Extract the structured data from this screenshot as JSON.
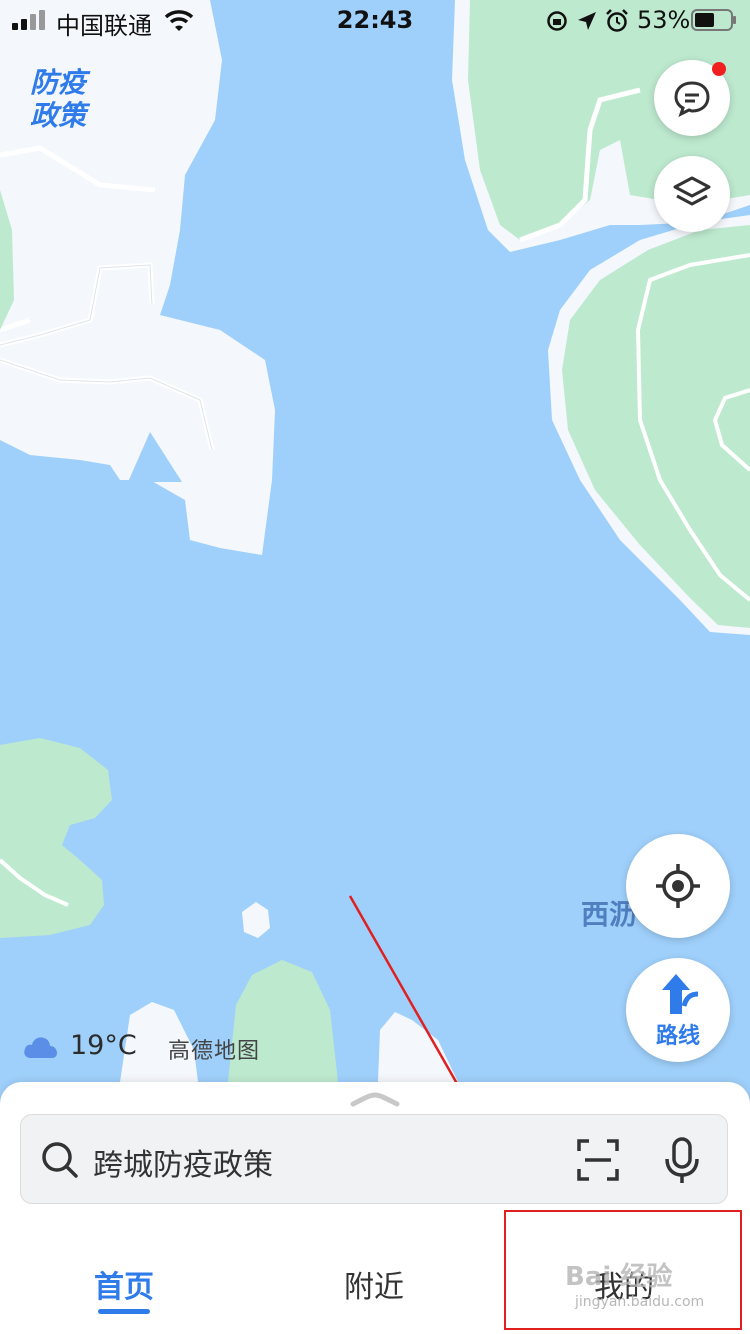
{
  "status_bar": {
    "carrier": "中国联通",
    "time": "22:43",
    "battery": "53%"
  },
  "map": {
    "policy_label_line1": "防疫",
    "policy_label_line2": "政策",
    "place_label": "西沥"
  },
  "controls": {
    "route_label": "路线"
  },
  "weather": {
    "temperature": "19°C"
  },
  "brand": {
    "name": "高德地图"
  },
  "search": {
    "placeholder": "跨城防疫政策"
  },
  "tabs": [
    {
      "label": "首页"
    },
    {
      "label": "附近"
    },
    {
      "label": "我的"
    }
  ],
  "watermark": {
    "main": "Bai 经验",
    "sub": "jingyan.baidu.com"
  },
  "colors": {
    "water": "#9fd0fb",
    "land": "#f4f7fc",
    "green": "#bde9cf",
    "accent": "#2f7bea",
    "annotation": "#e02020"
  }
}
